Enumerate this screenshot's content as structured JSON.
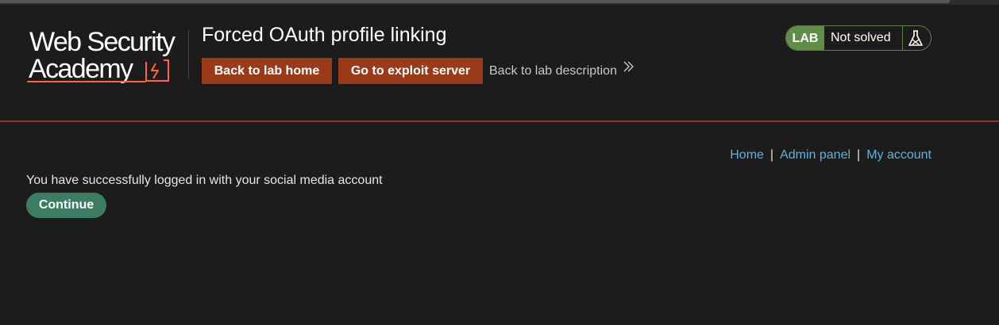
{
  "logo": {
    "line1": "Web Security",
    "line2": "Academy"
  },
  "header": {
    "title": "Forced OAuth profile linking",
    "back_home_label": "Back to lab home",
    "exploit_label": "Go to exploit server",
    "back_desc_label": "Back to lab description"
  },
  "status": {
    "badge": "LAB",
    "text": "Not solved"
  },
  "nav": {
    "items": [
      "Home",
      "Admin panel",
      "My account"
    ],
    "separator": "|"
  },
  "main": {
    "message": "You have successfully logged in with your social media account",
    "continue_label": "Continue"
  },
  "colors": {
    "background": "#1c1c1c",
    "accent_orange": "#9b3a1b",
    "lab_green": "#5f8f45",
    "continue_green": "#3a7d63",
    "link_blue": "#5ab3e0"
  }
}
